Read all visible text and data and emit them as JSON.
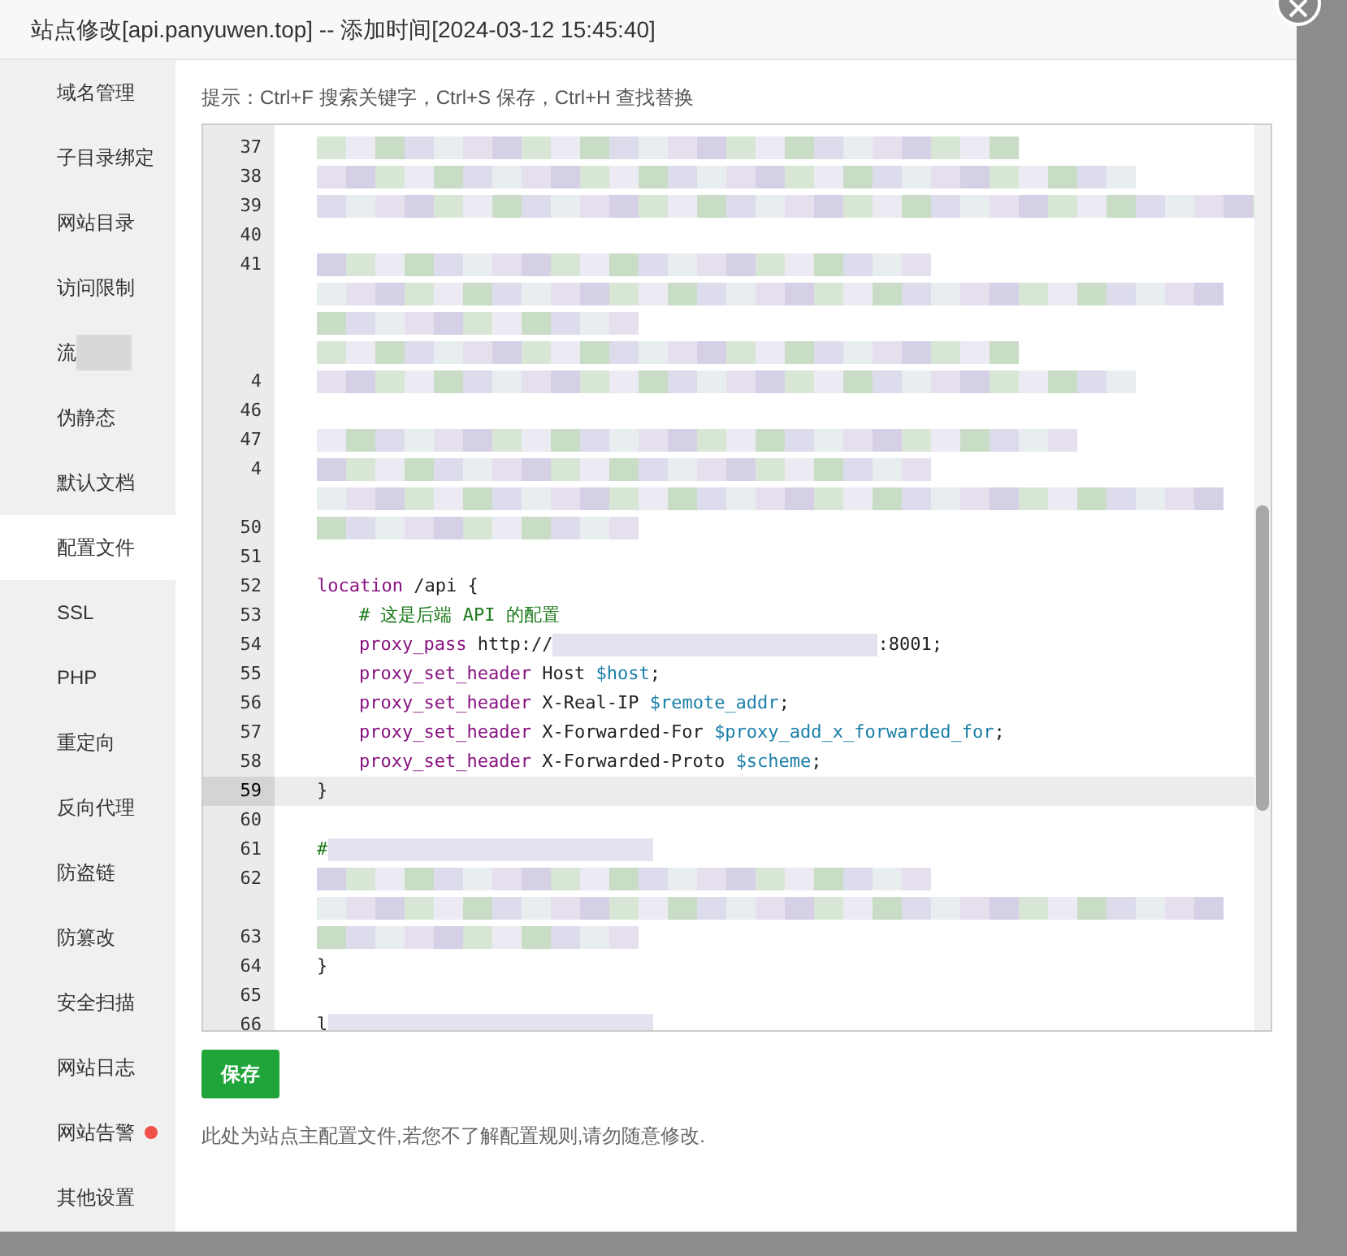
{
  "window": {
    "title": "站点修改[api.panyuwen.top] -- 添加时间[2024-03-12 15:45:40]"
  },
  "sidebar": {
    "items": [
      {
        "label": "域名管理",
        "selected": false,
        "alert": false,
        "redacted": false
      },
      {
        "label": "子目录绑定",
        "selected": false,
        "alert": false,
        "redacted": false
      },
      {
        "label": "网站目录",
        "selected": false,
        "alert": false,
        "redacted": false
      },
      {
        "label": "访问限制",
        "selected": false,
        "alert": false,
        "redacted": false
      },
      {
        "label": "流",
        "selected": false,
        "alert": false,
        "redacted": true
      },
      {
        "label": "伪静态",
        "selected": false,
        "alert": false,
        "redacted": false
      },
      {
        "label": "默认文档",
        "selected": false,
        "alert": false,
        "redacted": false
      },
      {
        "label": "配置文件",
        "selected": true,
        "alert": false,
        "redacted": false
      },
      {
        "label": "SSL",
        "selected": false,
        "alert": false,
        "redacted": false
      },
      {
        "label": "PHP",
        "selected": false,
        "alert": false,
        "redacted": false
      },
      {
        "label": "重定向",
        "selected": false,
        "alert": false,
        "redacted": false
      },
      {
        "label": "反向代理",
        "selected": false,
        "alert": false,
        "redacted": false
      },
      {
        "label": "防盗链",
        "selected": false,
        "alert": false,
        "redacted": false
      },
      {
        "label": "防篡改",
        "selected": false,
        "alert": false,
        "redacted": false
      },
      {
        "label": "安全扫描",
        "selected": false,
        "alert": false,
        "redacted": false
      },
      {
        "label": "网站日志",
        "selected": false,
        "alert": false,
        "redacted": false
      },
      {
        "label": "网站告警",
        "selected": false,
        "alert": true,
        "redacted": false
      },
      {
        "label": "其他设置",
        "selected": false,
        "alert": false,
        "redacted": false
      }
    ]
  },
  "hint": "提示：Ctrl+F 搜索关键字，Ctrl+S 保存，Ctrl+H 查找替换",
  "editor": {
    "lines": [
      {
        "num": "37",
        "kind": "redacted",
        "current": false
      },
      {
        "num": "38",
        "kind": "redacted",
        "current": false
      },
      {
        "num": "39",
        "kind": "redacted",
        "current": false
      },
      {
        "num": "40",
        "kind": "blank",
        "current": false
      },
      {
        "num": "41",
        "kind": "redacted",
        "current": false
      },
      {
        "kind": "redacted",
        "current": false
      },
      {
        "kind": "redacted",
        "current": false
      },
      {
        "kind": "redacted",
        "current": false
      },
      {
        "num": "4",
        "kind": "redacted",
        "current": false
      },
      {
        "num": "46",
        "kind": "blank",
        "current": false
      },
      {
        "num": "47",
        "kind": "redacted",
        "current": false
      },
      {
        "num": "4",
        "kind": "redacted",
        "current": false
      },
      {
        "kind": "redacted",
        "current": false
      },
      {
        "num": "50",
        "kind": "redacted",
        "current": false
      },
      {
        "num": "51",
        "kind": "blank",
        "current": false
      },
      {
        "num": "52",
        "kind": "code",
        "current": false,
        "indented": false,
        "tokens": [
          {
            "kind": "keyword",
            "text": "location"
          },
          {
            "kind": "plain",
            "text": " /api {"
          }
        ]
      },
      {
        "num": "53",
        "kind": "code",
        "current": false,
        "indented": true,
        "tokens": [
          {
            "kind": "comment",
            "text": "# 这是后端 API 的配置"
          }
        ]
      },
      {
        "num": "54",
        "kind": "code",
        "current": false,
        "indented": true,
        "tokens": [
          {
            "kind": "keyword",
            "text": "proxy_pass"
          },
          {
            "kind": "plain",
            "text": " http://"
          },
          {
            "kind": "blur"
          },
          {
            "kind": "plain",
            "text": ":8001;"
          }
        ]
      },
      {
        "num": "55",
        "kind": "code",
        "current": false,
        "indented": true,
        "tokens": [
          {
            "kind": "keyword",
            "text": "proxy_set_header"
          },
          {
            "kind": "plain",
            "text": " Host "
          },
          {
            "kind": "variable",
            "text": "$host"
          },
          {
            "kind": "plain",
            "text": ";"
          }
        ]
      },
      {
        "num": "56",
        "kind": "code",
        "current": false,
        "indented": true,
        "tokens": [
          {
            "kind": "keyword",
            "text": "proxy_set_header"
          },
          {
            "kind": "plain",
            "text": " X-Real-IP "
          },
          {
            "kind": "variable",
            "text": "$remote_addr"
          },
          {
            "kind": "plain",
            "text": ";"
          }
        ]
      },
      {
        "num": "57",
        "kind": "code",
        "current": false,
        "indented": true,
        "tokens": [
          {
            "kind": "keyword",
            "text": "proxy_set_header"
          },
          {
            "kind": "plain",
            "text": " X-Forwarded-For "
          },
          {
            "kind": "variable",
            "text": "$proxy_add_x_forwarded_for"
          },
          {
            "kind": "plain",
            "text": ";"
          }
        ]
      },
      {
        "num": "58",
        "kind": "code",
        "current": false,
        "indented": true,
        "tokens": [
          {
            "kind": "keyword",
            "text": "proxy_set_header"
          },
          {
            "kind": "plain",
            "text": " X-Forwarded-Proto "
          },
          {
            "kind": "variable",
            "text": "$scheme"
          },
          {
            "kind": "plain",
            "text": ";"
          }
        ]
      },
      {
        "num": "59",
        "kind": "code",
        "current": true,
        "indented": false,
        "tokens": [
          {
            "kind": "plain",
            "text": "}"
          }
        ]
      },
      {
        "num": "60",
        "kind": "blank",
        "current": false
      },
      {
        "num": "61",
        "kind": "code",
        "current": false,
        "indented": false,
        "tokens": [
          {
            "kind": "comment",
            "text": "#"
          },
          {
            "kind": "blur"
          }
        ]
      },
      {
        "num": "62",
        "kind": "redacted",
        "current": false
      },
      {
        "kind": "redacted",
        "current": false
      },
      {
        "num": "63",
        "kind": "redacted",
        "current": false
      },
      {
        "num": "64",
        "kind": "code",
        "current": false,
        "indented": false,
        "tokens": [
          {
            "kind": "plain",
            "text": "}"
          }
        ]
      },
      {
        "num": "65",
        "kind": "blank",
        "current": false
      },
      {
        "num": "66",
        "kind": "code",
        "current": false,
        "indented": false,
        "tokens": [
          {
            "kind": "plain",
            "text": "l"
          },
          {
            "kind": "blur"
          }
        ]
      }
    ]
  },
  "save_button": "保存",
  "note": "此处为站点主配置文件,若您不了解配置规则,请勿随意修改."
}
